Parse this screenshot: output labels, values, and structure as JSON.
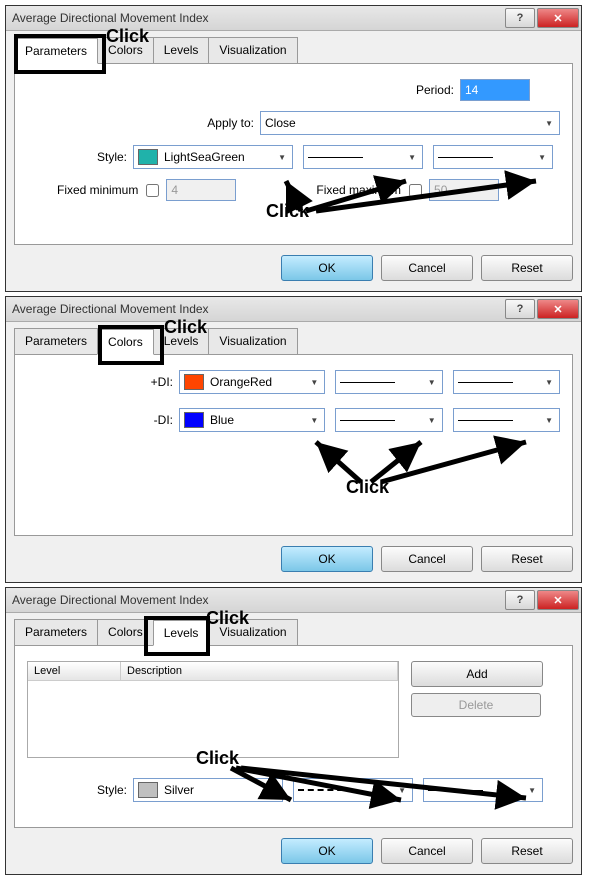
{
  "dialogs": {
    "title": "Average Directional Movement Index",
    "help_glyph": "?",
    "close_glyph": "✕",
    "tabs": {
      "parameters": "Parameters",
      "colors": "Colors",
      "levels": "Levels",
      "visualization": "Visualization"
    },
    "buttons": {
      "ok": "OK",
      "cancel": "Cancel",
      "reset": "Reset",
      "add": "Add",
      "delete": "Delete"
    }
  },
  "d1": {
    "period_label": "Period:",
    "period_value": "14",
    "applyto_label": "Apply to:",
    "applyto_value": "Close",
    "style_label": "Style:",
    "style_color_name": "LightSeaGreen",
    "style_color_hex": "#20b2aa",
    "fixed_min_label": "Fixed minimum",
    "fixed_min_value": "4",
    "fixed_max_label": "Fixed maximum",
    "fixed_max_value": "50",
    "annotation": "Click",
    "annotation2": "Click"
  },
  "d2": {
    "plus_di_label": "+DI:",
    "plus_di_color_name": "OrangeRed",
    "plus_di_color_hex": "#ff4500",
    "minus_di_label": "-DI:",
    "minus_di_color_name": "Blue",
    "minus_di_color_hex": "#0000ff",
    "annotation": "Click",
    "annotation2": "Click"
  },
  "d3": {
    "col_level": "Level",
    "col_desc": "Description",
    "style_label": "Style:",
    "style_color_name": "Silver",
    "style_color_hex": "#c0c0c0",
    "annotation": "Click",
    "annotation2": "Click"
  }
}
